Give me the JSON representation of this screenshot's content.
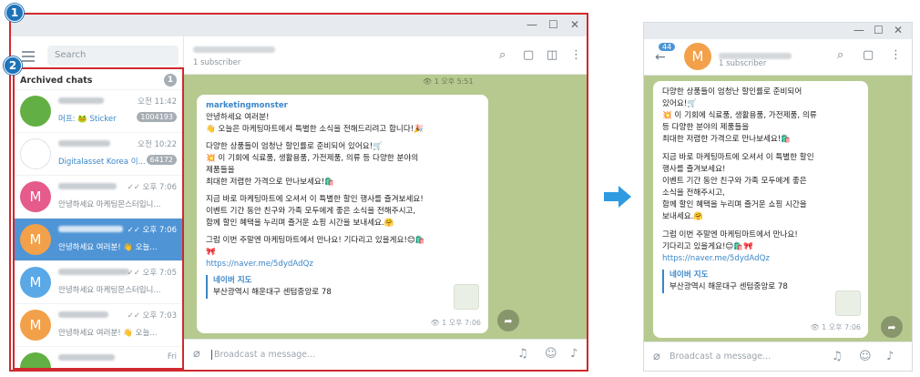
{
  "steps": {
    "one": "1",
    "two": "2"
  },
  "left": {
    "search_placeholder": "Search",
    "archived_title": "Archived chats",
    "archived_count": "1",
    "chats": [
      {
        "avatar": "",
        "color": "#62b043",
        "time": "오전 11:42",
        "sub": "머프: 🐸 Sticker",
        "count": "1004193",
        "sub_blue": true
      },
      {
        "avatar": "",
        "color": "#ffffff",
        "time": "오전 10:22",
        "sub": "Digitalasset Korea 이...",
        "count": "64172",
        "sub_blue": true
      },
      {
        "avatar": "M",
        "color": "#e55b8c",
        "time": "✓✓ 오후 7:06",
        "sub": "안녕하세요 마케팅몬스터입니...",
        "count": "",
        "sub_blue": false
      },
      {
        "avatar": "M",
        "color": "#f2a14a",
        "time": "✓✓ 오후 7:06",
        "sub": "안녕하세요 여러분! 👋 오늘...",
        "count": "",
        "sub_blue": false
      },
      {
        "avatar": "M",
        "color": "#5aa8e6",
        "time": "✓✓ 오후 7:05",
        "sub": "안녕하세요 마케팅몬스터입니...",
        "count": "",
        "sub_blue": false
      },
      {
        "avatar": "M",
        "color": "#f2a14a",
        "time": "✓✓ 오후 7:03",
        "sub": "안녕하세요 여러분! 👋 오늘...",
        "count": "",
        "sub_blue": false
      },
      {
        "avatar": "",
        "color": "#62b043",
        "time": "Fri",
        "sub": "",
        "count": "",
        "sub_blue": false
      }
    ],
    "channel_title": "marketingmonster",
    "channel_sub": "1 subscriber",
    "top_views": "👁 1 오후 5:51",
    "msg": {
      "sender": "marketingmonster",
      "l1": "안녕하세요 여러분!",
      "l2": "👋 오늘은 마케팅마트에서 특별한 소식을 전해드리려고 합니다!🎉",
      "l3": "다양한 상품들이 엄청난 할인률로 준비되어 있어요!🛒",
      "l4": "💥 이 기회에 식료품, 생활용품, 가전제품, 의류 등 다양한 분야의",
      "l5": "제품들을",
      "l6": "최대한 저렴한 가격으로 만나보세요!🛍️",
      "l7": "지금 바로 마케팅마트에 오셔서 이 특별한 할인 행사를 즐겨보세요!",
      "l8": "이벤트 기간 동안 친구와 가족 모두에게 좋은 소식을 전해주시고,",
      "l9": "함께 할인 혜택을 누리며 즐거운 쇼핑 시간을 보내세요.🤗",
      "l10": "그럼 이번 주말엔 마케팅마트에서 만나요! 기다리고 있을게요!😊🛍️",
      "l11": "🎀",
      "link": "https://naver.me/5dydAdQz",
      "loc_title": "네이버 지도",
      "loc_addr": "부산광역시 해운대구 센텀중앙로 78",
      "time": "👁 1 오후 7:06"
    },
    "composer_placeholder": "Broadcast a message..."
  },
  "right": {
    "back_badge": "44",
    "channel_sub": "1 subscriber",
    "avatar": "M",
    "l1": "다양한 상품들이 엄청난 할인률로 준비되어",
    "l2": "있어요!🛒",
    "l3": "💥 이 기회에 식료품, 생활용품, 가전제품, 의류",
    "l4": "등 다양한 분야의 제품들을",
    "l5": "최대한 저렴한 가격으로 만나보세요!🛍️",
    "l6": "지금 바로 마케팅마트에 오셔서 이 특별한 할인",
    "l7": "행사를 즐겨보세요!",
    "l8": "이벤트 기간 동안 친구와 가족 모두에게 좋은",
    "l9": "소식을 전해주시고,",
    "l10": "함께 할인 혜택을 누리며 즐거운 쇼핑 시간을",
    "l11": "보내세요.🤗",
    "l12": "그럼 이번 주말엔 마케팅마트에서 만나요!",
    "l13": "기다리고 있을게요!😊🛍️🎀",
    "link": "https://naver.me/5dydAdQz",
    "loc_title": "네이버 지도",
    "loc_addr": "부산광역시 해운대구 센텀중앙로 78",
    "time": "👁 1 오후 7:06",
    "composer_placeholder": "Broadcast a message..."
  }
}
